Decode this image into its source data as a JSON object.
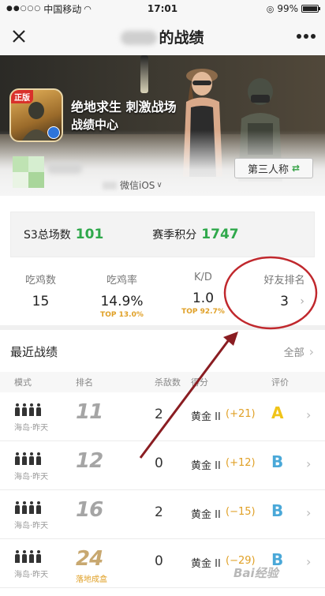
{
  "status_bar": {
    "carrier": "中国移动",
    "time": "17:01",
    "battery": "99%",
    "battery_level": 0.99
  },
  "nav": {
    "title_suffix": "的战绩"
  },
  "banner": {
    "icon_tag": "正版",
    "title": "绝地求生 刺激战场",
    "subtitle": "战绩中心"
  },
  "profile": {
    "platform": "微信iOS",
    "perspective_button": "第三人称"
  },
  "summary": {
    "matches_label": "S3总场数",
    "matches_value": "101",
    "season_label": "赛季积分",
    "season_value": "1747"
  },
  "stats": [
    {
      "label": "吃鸡数",
      "value": "15",
      "sub": ""
    },
    {
      "label": "吃鸡率",
      "value": "14.9%",
      "sub": "TOP 13.0%"
    },
    {
      "label": "K/D",
      "value": "1.0",
      "sub": "TOP 92.7%"
    },
    {
      "label": "好友排名",
      "value": "3",
      "sub": ""
    }
  ],
  "recent": {
    "title": "最近战绩",
    "all_label": "全部"
  },
  "table_headers": {
    "mode": "模式",
    "rank": "排名",
    "kills": "杀敌数",
    "score": "得分",
    "grade": "评价"
  },
  "matches": [
    {
      "map": "海岛·昨天",
      "rank": "11",
      "note": "",
      "kills": "2",
      "tier": "黄金 II",
      "delta": "(+21)",
      "grade": "A",
      "grade_color": "#f0c419"
    },
    {
      "map": "海岛·昨天",
      "rank": "12",
      "note": "",
      "kills": "0",
      "tier": "黄金 II",
      "delta": "(+12)",
      "grade": "B",
      "grade_color": "#4aa8d8"
    },
    {
      "map": "海岛·昨天",
      "rank": "16",
      "note": "",
      "kills": "2",
      "tier": "黄金 II",
      "delta": "(−15)",
      "grade": "B",
      "grade_color": "#4aa8d8"
    },
    {
      "map": "海岛·昨天",
      "rank": "24",
      "note": "落地成盒",
      "kills": "0",
      "tier": "黄金 II",
      "delta": "(−29)",
      "grade": "B",
      "grade_color": "#4aa8d8"
    }
  ],
  "annotation": {
    "circle_color": "#c0282d",
    "arrow_color": "#8a1d22"
  },
  "watermark": "Bai经验"
}
